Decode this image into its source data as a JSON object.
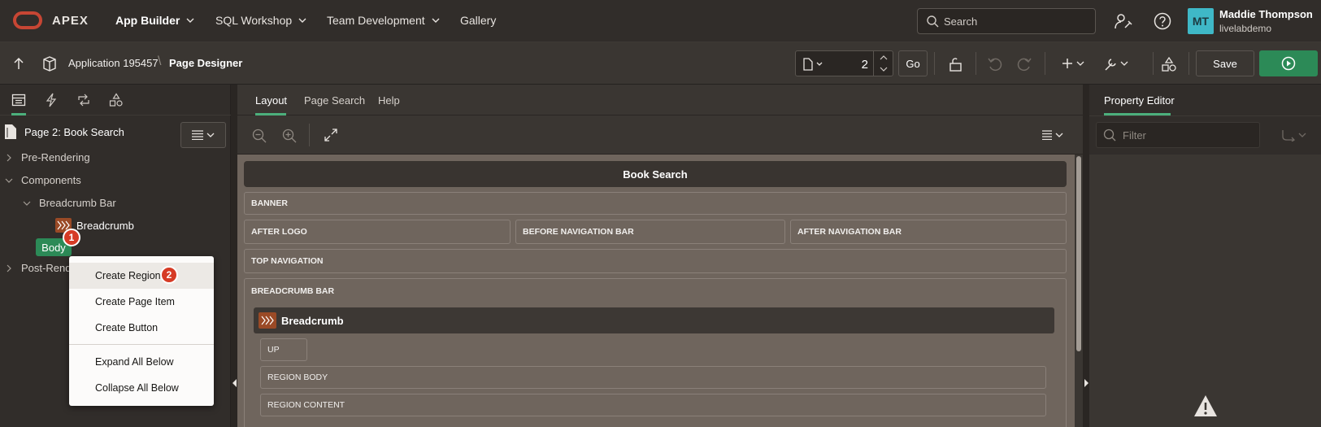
{
  "header": {
    "brand": "APEX",
    "nav": [
      {
        "label": "App Builder"
      },
      {
        "label": "SQL Workshop"
      },
      {
        "label": "Team Development"
      },
      {
        "label": "Gallery"
      }
    ],
    "search_placeholder": "Search",
    "user": {
      "initials": "MT",
      "name": "Maddie Thompson",
      "workspace": "livelabdemo"
    }
  },
  "toolbar": {
    "app_crumb": "Application 195457",
    "separator": "\\",
    "current": "Page Designer",
    "page_number": "2",
    "go_label": "Go",
    "save_label": "Save"
  },
  "left": {
    "page_title": "Page 2: Book Search",
    "tree": {
      "pre_rendering": "Pre-Rendering",
      "components": "Components",
      "breadcrumb_bar": "Breadcrumb Bar",
      "breadcrumb": "Breadcrumb",
      "body": "Body",
      "post_rendering": "Post-Rend"
    },
    "badge1": "1"
  },
  "context_menu": {
    "items": [
      {
        "label": "Create Region"
      },
      {
        "label": "Create Page Item"
      },
      {
        "label": "Create Button"
      },
      {
        "label": "Expand All Below"
      },
      {
        "label": "Collapse All Below"
      }
    ],
    "badge2": "2"
  },
  "center": {
    "tabs": [
      {
        "label": "Layout"
      },
      {
        "label": "Page Search"
      },
      {
        "label": "Help"
      }
    ],
    "canvas": {
      "title": "Book Search",
      "slots": {
        "banner": "BANNER",
        "after_logo": "AFTER LOGO",
        "before_nav": "BEFORE NAVIGATION BAR",
        "after_nav": "AFTER NAVIGATION BAR",
        "top_nav": "TOP NAVIGATION",
        "breadcrumb_bar": "BREADCRUMB BAR",
        "breadcrumb_region": "Breadcrumb",
        "up": "UP",
        "region_body": "REGION BODY",
        "region_content": "REGION CONTENT"
      }
    }
  },
  "right": {
    "tab": "Property Editor",
    "filter_placeholder": "Filter"
  },
  "colors": {
    "accent_green": "#2c8a57",
    "badge_red": "#d63b25",
    "oracle_red": "#c74634",
    "avatar_teal": "#3fb8c7"
  }
}
